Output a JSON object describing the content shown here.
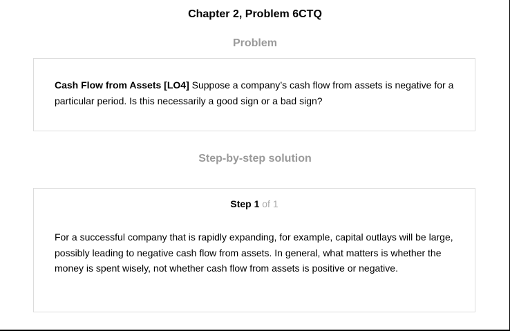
{
  "header": {
    "chapter_title": "Chapter 2, Problem 6CTQ"
  },
  "problem": {
    "heading": "Problem",
    "lead": "Cash Flow from Assets [LO4]",
    "text": " Suppose a company’s cash flow from assets is negative for a particular period. Is this necessarily a good sign or a bad sign?"
  },
  "solution": {
    "heading": "Step-by-step solution",
    "step_label": "Step 1",
    "step_total": " of 1",
    "text": "For a successful company that is rapidly expanding, for example, capital outlays will be large, possibly leading to negative cash flow from assets. In general, what matters is whether the money is spent wisely, not whether cash flow from assets is positive or negative."
  }
}
